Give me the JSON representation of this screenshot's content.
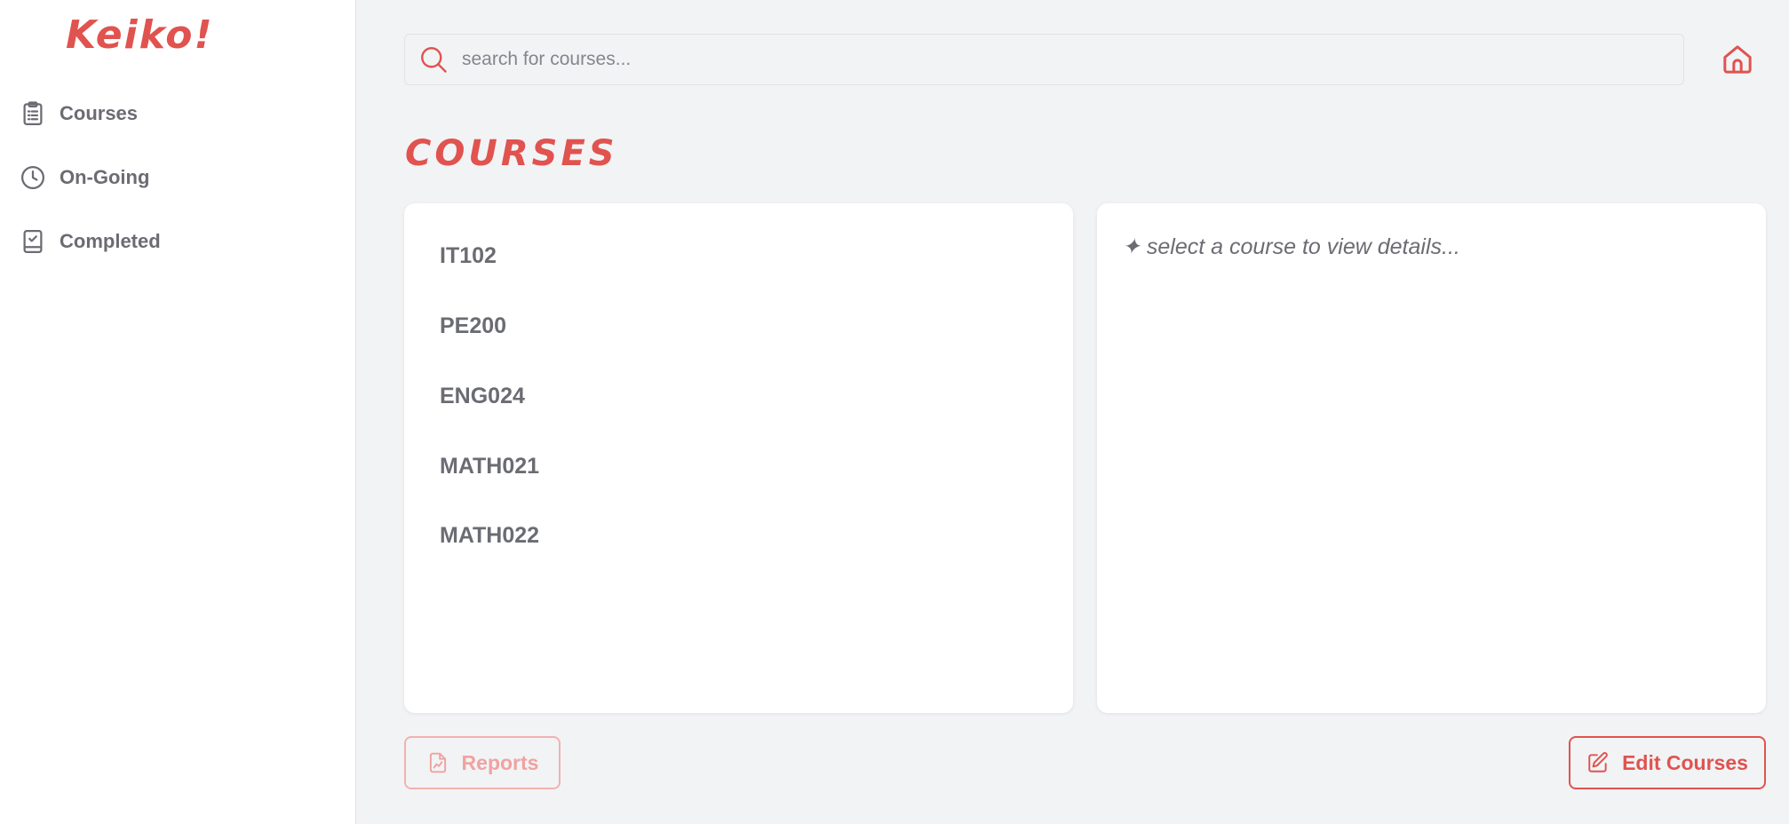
{
  "app": {
    "logo": "Keiko!"
  },
  "sidebar": {
    "items": [
      {
        "label": "Courses",
        "icon": "clipboard-list-icon"
      },
      {
        "label": "On-Going",
        "icon": "clock-icon"
      },
      {
        "label": "Completed",
        "icon": "clipboard-check-icon"
      }
    ]
  },
  "search": {
    "placeholder": "search for courses..."
  },
  "header": {
    "home_icon": "home-icon"
  },
  "main": {
    "title": "COURSES",
    "courses": [
      "IT102",
      "PE200",
      "ENG024",
      "MATH021",
      "MATH022"
    ],
    "details_placeholder": "✦ select a course to view details..."
  },
  "actions": {
    "reports_label": "Reports",
    "edit_label": "Edit Courses"
  },
  "colors": {
    "accent": "#e0534f",
    "accent_light": "#f1b2b0",
    "text_muted": "#6b6c73",
    "background": "#f2f3f5"
  }
}
